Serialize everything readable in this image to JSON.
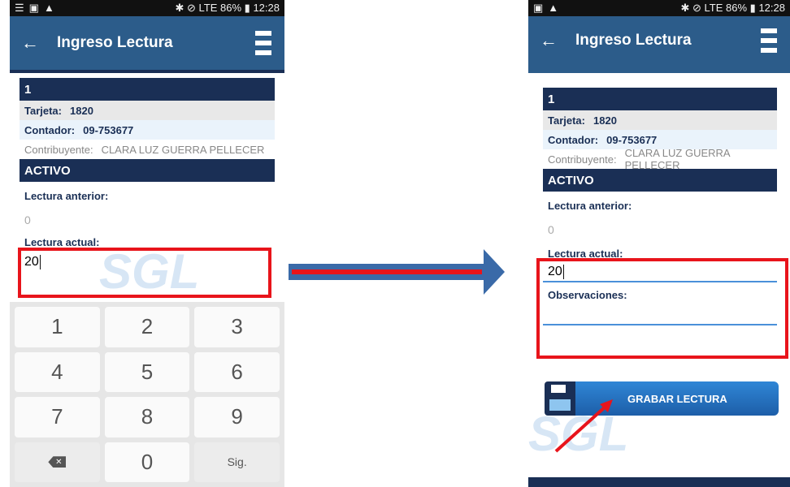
{
  "status": {
    "time": "12:28",
    "battery": "86%",
    "network": "LTE"
  },
  "appbar": {
    "title": "Ingreso Lectura"
  },
  "record": {
    "number": "1",
    "tarjeta_label": "Tarjeta:",
    "tarjeta_value": "1820",
    "contador_label": "Contador:",
    "contador_value": "09-753677",
    "contribuyente_label": "Contribuyente:",
    "contribuyente_value": "CLARA LUZ GUERRA PELLECER",
    "estado": "ACTIVO"
  },
  "form": {
    "lectura_anterior_label": "Lectura anterior:",
    "lectura_anterior_value": "0",
    "lectura_actual_label": "Lectura actual:",
    "lectura_actual_value": "20",
    "observaciones_label": "Observaciones:"
  },
  "keyboard": {
    "keys": [
      "1",
      "2",
      "3",
      "4",
      "5",
      "6",
      "7",
      "8",
      "9",
      "",
      "0",
      "Sig."
    ]
  },
  "save_button": {
    "label": "GRABAR LECTURA"
  },
  "colors": {
    "primary": "#2c5c8a",
    "dark": "#1a2f55",
    "highlight": "#e8141b",
    "arrow": "#3a6aa8"
  }
}
